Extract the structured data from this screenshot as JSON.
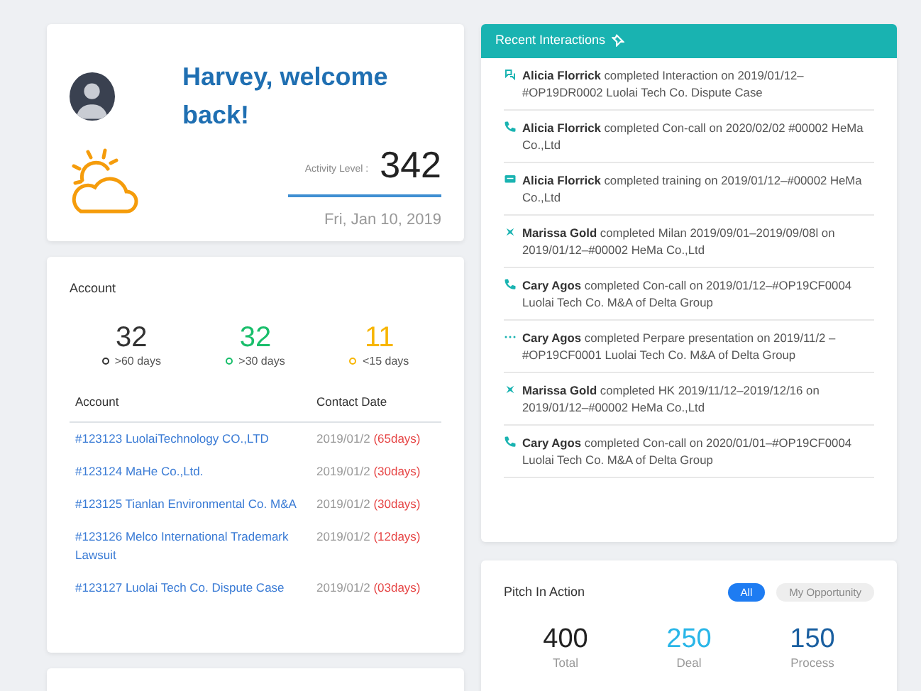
{
  "welcome": {
    "greeting": "Harvey, welcome back!",
    "activity_label": "Activity Level :",
    "activity_value": "342",
    "date": "Fri, Jan 10, 2019"
  },
  "account": {
    "title": "Account",
    "stats": [
      {
        "value": "32",
        "label": ">60 days",
        "color": "#333333"
      },
      {
        "value": "32",
        "label": ">30 days",
        "color": "#19be6b"
      },
      {
        "value": "11",
        "label": "<15 days",
        "color": "#f7b500"
      }
    ],
    "columns": [
      "Account",
      "Contact Date"
    ],
    "rows": [
      {
        "account": "#123123 LuolaiTechnology CO.,LTD",
        "date": "2019/01/2",
        "days": "(65days)"
      },
      {
        "account": "#123124 MaHe Co.,Ltd.",
        "date": "2019/01/2",
        "days": "(30days)"
      },
      {
        "account": "#123125 Tianlan Environmental Co. M&A",
        "date": "2019/01/2",
        "days": "(30days)"
      },
      {
        "account": "#123126 Melco International Trademark Lawsuit",
        "date": "2019/01/2",
        "days": "(12days)"
      },
      {
        "account": "#123127 Luolai Tech Co. Dispute Case",
        "date": "2019/01/2",
        "days": "(03days)"
      }
    ]
  },
  "interactions": {
    "title": "Recent Interactions",
    "items": [
      {
        "kind": "interaction",
        "text": "**Alicia Florrick** completed Interaction on 2019/01/12–#OP19DR0002 Luolai Tech Co. Dispute Case"
      },
      {
        "kind": "call",
        "text": "**Alicia Florrick** completed Con-call on 2020/02/02 #00002 HeMa Co.,Ltd"
      },
      {
        "kind": "training",
        "text": "**Alicia Florrick** completed training on 2019/01/12–#00002 HeMa Co.,Ltd"
      },
      {
        "kind": "flight",
        "text": "**Marissa Gold** completed Milan 2019/09/01–2019/09/08l on 2019/01/12–#00002 HeMa Co.,Ltd"
      },
      {
        "kind": "call",
        "text": "**Cary Agos** completed Con-call on 2019/01/12–#OP19CF0004 Luolai Tech Co. M&A of Delta Group"
      },
      {
        "kind": "presentation",
        "text": "**Cary Agos** completed Perpare presentation on 2019/11/2 –#OP19CF0001 Luolai Tech Co. M&A of Delta Group"
      },
      {
        "kind": "flight",
        "text": "**Marissa Gold** completed HK 2019/11/12–2019/12/16 on 2019/01/12–#00002 HeMa Co.,Ltd"
      },
      {
        "kind": "call",
        "text": "**Cary Agos** completed Con-call on 2020/01/01–#OP19CF0004 Luolai Tech Co. M&A of Delta Group"
      }
    ]
  },
  "pitch": {
    "title": "Pitch In Action",
    "tabs": [
      {
        "label": "All",
        "selected": true
      },
      {
        "label": "My Opportunity",
        "selected": false
      }
    ],
    "stats": [
      {
        "value": "400",
        "label": "Total",
        "color": "#222222"
      },
      {
        "value": "250",
        "label": "Deal",
        "color": "#29b6e8"
      },
      {
        "value": "150",
        "label": "Process",
        "color": "#1a5fa0"
      }
    ]
  }
}
